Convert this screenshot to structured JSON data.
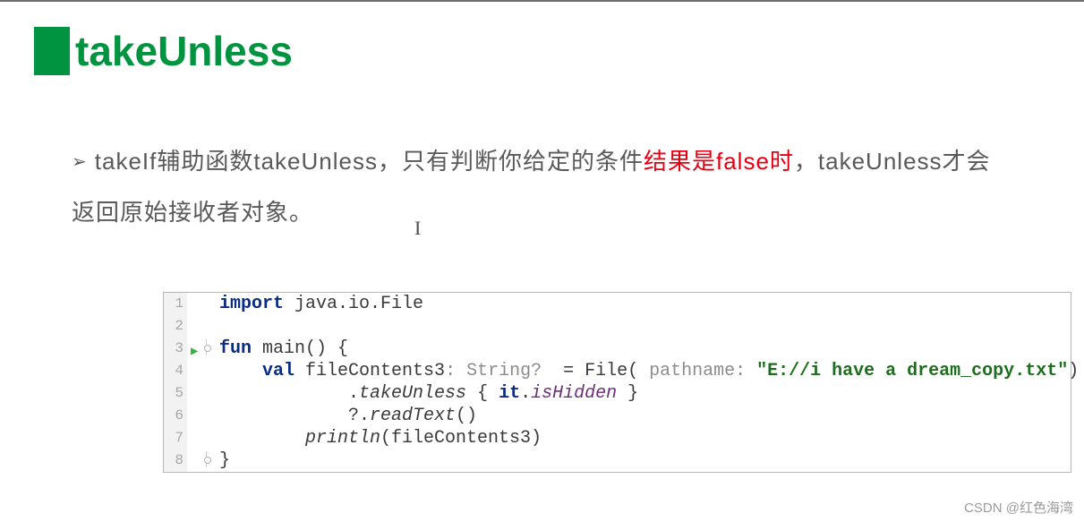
{
  "heading": {
    "title": "takeUnless"
  },
  "bullet": {
    "pre": "takeIf辅助函数takeUnless，只有判断你给定的条件",
    "hl": "结果是false时",
    "post": "，takeUnless才会",
    "line2": "返回原始接收者对象。"
  },
  "code": {
    "l1_kw": "import",
    "l1_rest": " java.io.File",
    "l3_kw1": "fun",
    "l3_mid": " main() {",
    "l4_kw": "val",
    "l4_mid1": " fileContents3",
    "l4_hint1": ": String? ",
    "l4_mid2": " = File(",
    "l4_hint2": " pathname: ",
    "l4_str": "\"E://i have a dream_copy.txt\"",
    "l4_end": ")",
    "l5_lead": "            .",
    "l5_call": "takeUnless",
    "l5_mid": " { ",
    "l5_kw": "it",
    "l5_dot": ".",
    "l5_prop": "isHidden",
    "l5_end": " }",
    "l6_lead": "            ?.",
    "l6_call": "readText",
    "l6_end": "()",
    "l7_lead": "        ",
    "l7_call": "println",
    "l7_arg": "(fileContents3)",
    "l8": "}"
  },
  "ln": {
    "1": "1",
    "2": "2",
    "3": "3",
    "4": "4",
    "5": "5",
    "6": "6",
    "7": "7",
    "8": "8"
  },
  "watermark": "CSDN @红色海湾"
}
